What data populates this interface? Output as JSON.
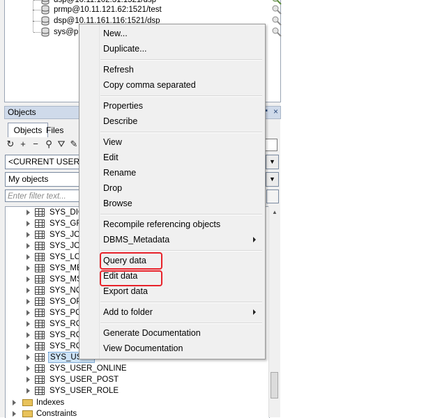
{
  "connections": [
    {
      "label": "dsp@10.11.102.31:1521/dsp"
    },
    {
      "label": "prmp@10.11.121.62:1521/test"
    },
    {
      "label": "dsp@10.11.161.116:1521/dsp"
    },
    {
      "label": "sys@prm"
    }
  ],
  "objects_panel": {
    "title": "Objects",
    "close_icon": "×",
    "tabs": [
      {
        "label": "Objects"
      },
      {
        "label": "Files"
      }
    ],
    "user_combo": "<CURRENT USER>",
    "scope_combo": "My objects",
    "filter_placeholder": "Enter filter text..."
  },
  "tree": {
    "tables": [
      "SYS_DICT",
      "SYS_GRO",
      "SYS_JOB",
      "SYS_JOB",
      "SYS_LOG",
      "SYS_MEN",
      "SYS_MSG",
      "SYS_NOT",
      "SYS_OPE",
      "SYS_POS",
      "SYS_ROL",
      "SYS_ROL",
      "SYS_ROL",
      "SYS_USER",
      "SYS_USER_ONLINE",
      "SYS_USER_POST",
      "SYS_USER_ROLE"
    ],
    "folders": [
      "Indexes",
      "Constraints"
    ]
  },
  "context_menu": {
    "items": [
      "New...",
      "Duplicate...",
      "Refresh",
      "Copy comma separated",
      "Properties",
      "Describe",
      "View",
      "Edit",
      "Rename",
      "Drop",
      "Browse",
      "Recompile referencing objects",
      "DBMS_Metadata",
      "Query data",
      "Edit data",
      "Export data",
      "Add to folder",
      "Generate Documentation",
      "View Documentation"
    ]
  },
  "colors": {
    "highlight_box": "#e8222a",
    "panel_title_bg": "#cfdaea"
  }
}
